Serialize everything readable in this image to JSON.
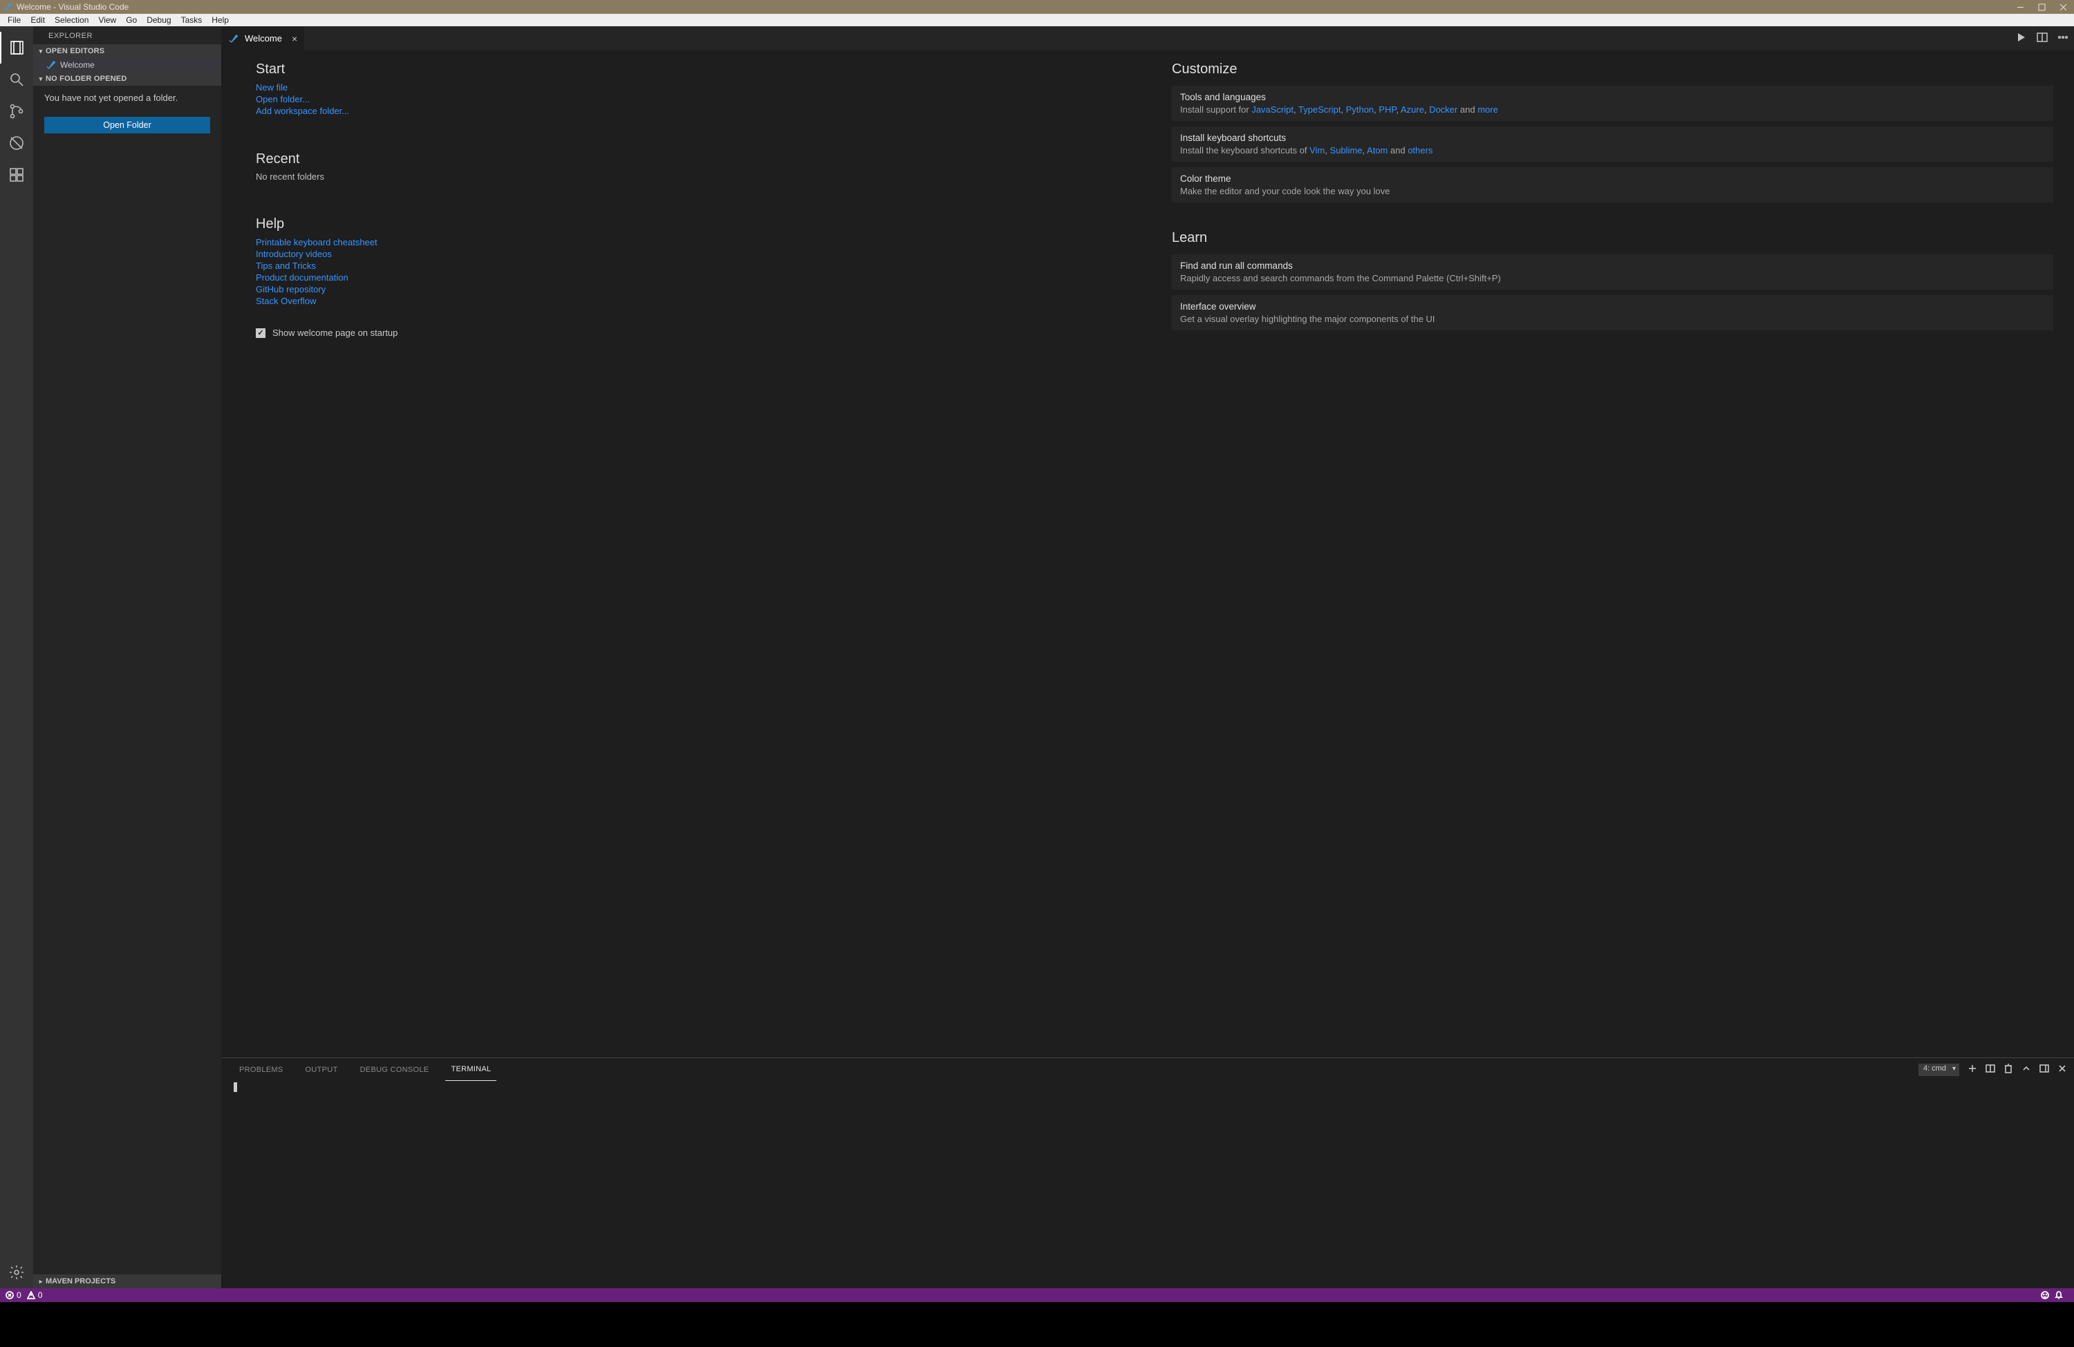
{
  "window": {
    "title": "Welcome - Visual Studio Code"
  },
  "menu": {
    "items": [
      "File",
      "Edit",
      "Selection",
      "View",
      "Go",
      "Debug",
      "Tasks",
      "Help"
    ]
  },
  "sidebar": {
    "title": "EXPLORER",
    "open_editors": {
      "header": "OPEN EDITORS",
      "items": [
        "Welcome"
      ]
    },
    "no_folder": {
      "header": "NO FOLDER OPENED",
      "message": "You have not yet opened a folder.",
      "button": "Open Folder"
    },
    "maven": {
      "header": "MAVEN PROJECTS"
    }
  },
  "tabs": {
    "active": "Welcome"
  },
  "welcome": {
    "start": {
      "heading": "Start",
      "links": [
        "New file",
        "Open folder...",
        "Add workspace folder..."
      ]
    },
    "recent": {
      "heading": "Recent",
      "empty": "No recent folders"
    },
    "help": {
      "heading": "Help",
      "links": [
        "Printable keyboard cheatsheet",
        "Introductory videos",
        "Tips and Tricks",
        "Product documentation",
        "GitHub repository",
        "Stack Overflow"
      ]
    },
    "show_checkbox": "Show welcome page on startup",
    "customize": {
      "heading": "Customize",
      "cards": [
        {
          "title": "Tools and languages",
          "prefix": "Install support for ",
          "links": [
            "JavaScript",
            "TypeScript",
            "Python",
            "PHP",
            "Azure",
            "Docker"
          ],
          "suffix_word": "and",
          "suffix_link": "more"
        },
        {
          "title": "Install keyboard shortcuts",
          "prefix": "Install the keyboard shortcuts of ",
          "links": [
            "Vim",
            "Sublime",
            "Atom"
          ],
          "suffix_word": "and",
          "suffix_link": "others"
        },
        {
          "title": "Color theme",
          "desc": "Make the editor and your code look the way you love"
        }
      ]
    },
    "learn": {
      "heading": "Learn",
      "cards": [
        {
          "title": "Find and run all commands",
          "desc": "Rapidly access and search commands from the Command Palette (Ctrl+Shift+P)"
        },
        {
          "title": "Interface overview",
          "desc": "Get a visual overlay highlighting the major components of the UI"
        }
      ]
    }
  },
  "panel": {
    "tabs": [
      "PROBLEMS",
      "OUTPUT",
      "DEBUG CONSOLE",
      "TERMINAL"
    ],
    "active": "TERMINAL",
    "terminal_select": "4: cmd"
  },
  "status": {
    "errors": "0",
    "warnings": "0"
  }
}
